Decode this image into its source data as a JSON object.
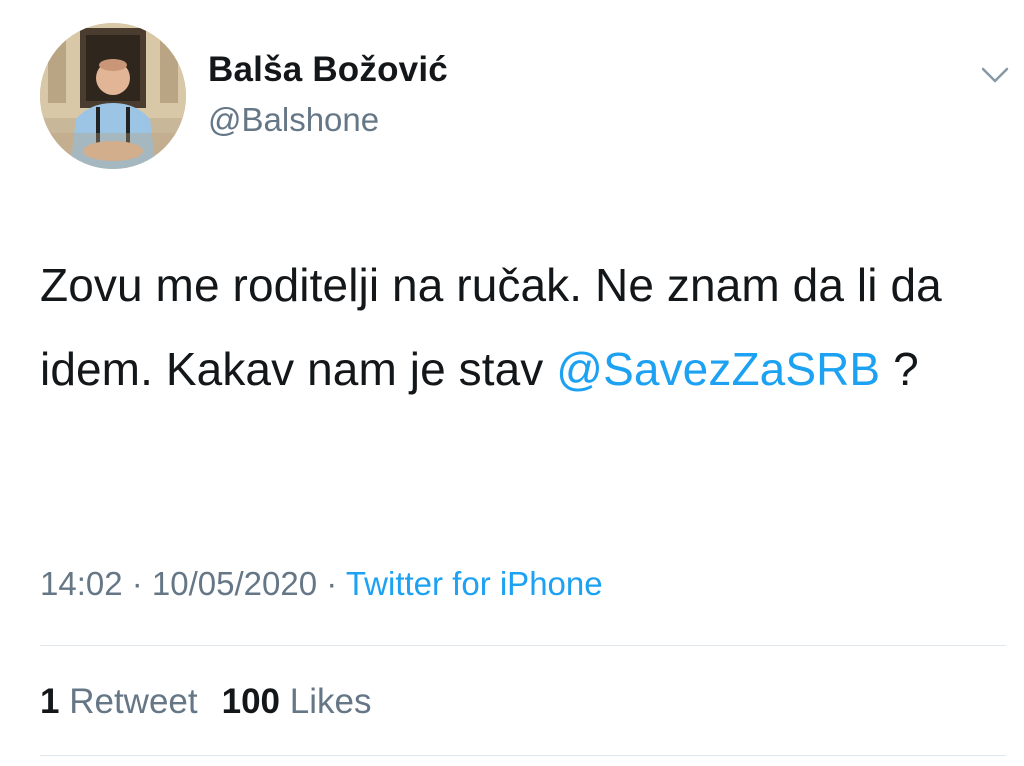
{
  "author": {
    "display_name": "Balša Božović",
    "handle": "@Balshone"
  },
  "tweet": {
    "text_before": "Zovu me roditelji na ručak. Ne znam da li da idem. Kakav nam je stav ",
    "mention": "@SavezZaSRB",
    "text_after": " ?"
  },
  "meta": {
    "time": "14:02",
    "separator": " · ",
    "date": "10/05/2020",
    "separator2": " · ",
    "source": "Twitter for iPhone"
  },
  "stats": {
    "retweets_count": "1",
    "retweets_label": "Retweet",
    "likes_count": "100",
    "likes_label": "Likes"
  },
  "colors": {
    "link": "#1da1f2",
    "secondary": "#657786",
    "primary": "#14171a",
    "divider": "#e1e8ed"
  },
  "icons": {
    "more": "chevron-down-icon"
  }
}
